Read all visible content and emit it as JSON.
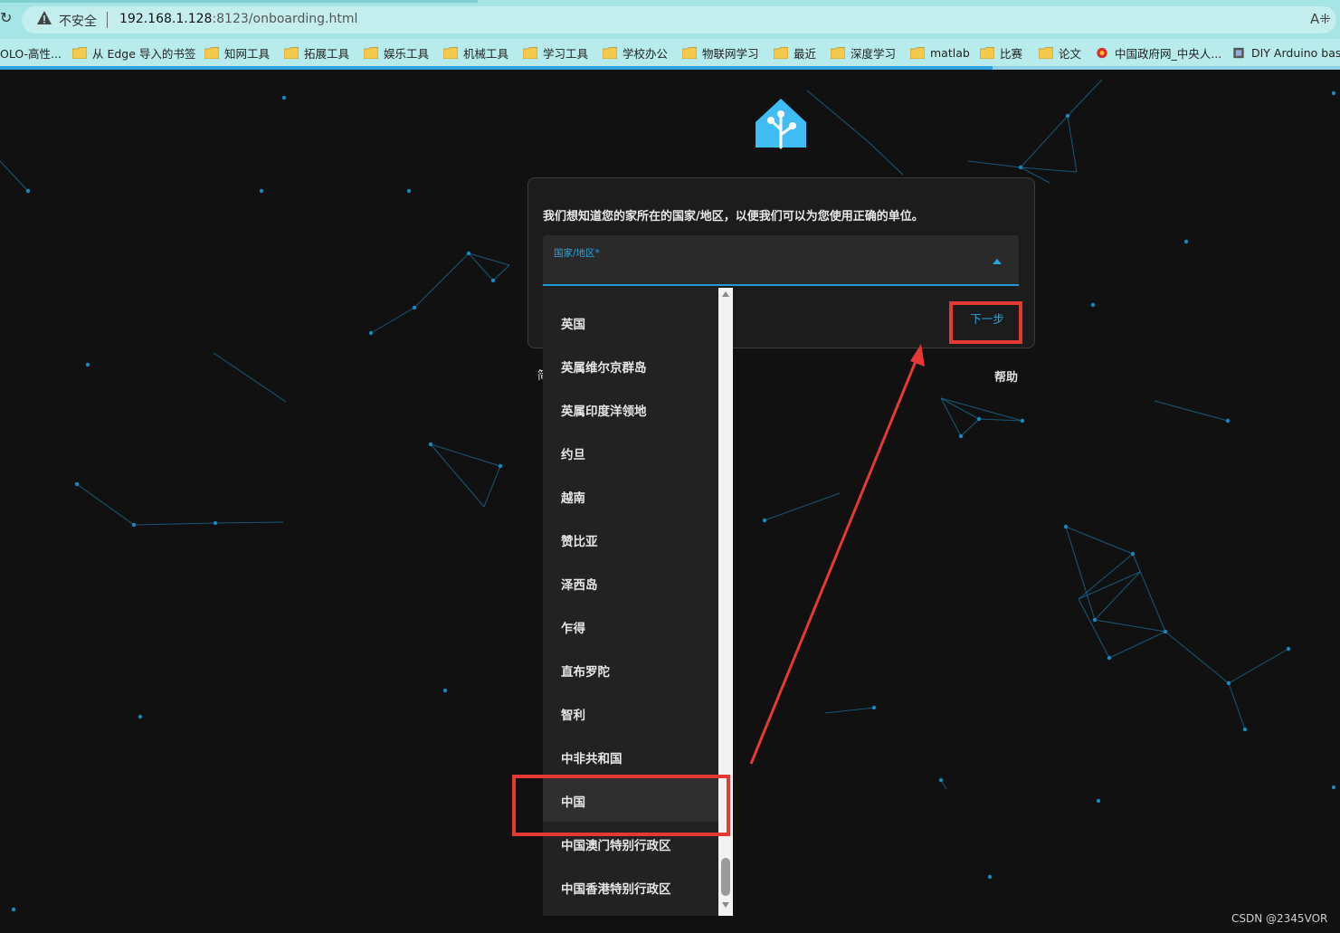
{
  "browser": {
    "security_label": "不安全",
    "url_host": "192.168.1.128",
    "url_rest": ":8123/onboarding.html",
    "read_aloud": "A͡",
    "bookmarks": [
      {
        "label": "OLO-高性...",
        "icon": "none"
      },
      {
        "label": "从 Edge 导入的书签",
        "icon": "folder-icon"
      },
      {
        "label": "知网工具",
        "icon": "folder-icon"
      },
      {
        "label": "拓展工具",
        "icon": "folder-icon"
      },
      {
        "label": "娱乐工具",
        "icon": "folder-icon"
      },
      {
        "label": "机械工具",
        "icon": "folder-icon"
      },
      {
        "label": "学习工具",
        "icon": "folder-icon"
      },
      {
        "label": "学校办公",
        "icon": "folder-icon"
      },
      {
        "label": "物联网学习",
        "icon": "folder-icon"
      },
      {
        "label": "最近",
        "icon": "folder-icon"
      },
      {
        "label": "深度学习",
        "icon": "folder-icon"
      },
      {
        "label": "matlab",
        "icon": "folder-icon"
      },
      {
        "label": "比赛",
        "icon": "folder-icon"
      },
      {
        "label": "论文",
        "icon": "folder-icon"
      },
      {
        "label": "中国政府网_中央人...",
        "icon": "emblem-icon"
      },
      {
        "label": "DIY Arduino based",
        "icon": "site-icon"
      }
    ]
  },
  "onboarding": {
    "intro": "我们想知道您的家所在的国家/地区，以便我们可以为您使用正确的单位。",
    "country_field_label": "国家/地区*",
    "next_button": "下一步",
    "help_link": "帮助",
    "language_stub": "简"
  },
  "country_options": [
    "英国",
    "英属维尔京群岛",
    "英属印度洋领地",
    "约旦",
    "越南",
    "赞比亚",
    "泽西岛",
    "乍得",
    "直布罗陀",
    "智利",
    "中非共和国",
    "中国",
    "中国澳门特别行政区",
    "中国香港特别行政区"
  ],
  "selected_option": "中国",
  "watermark": "CSDN @2345VOR",
  "colors": {
    "accent": "#2aa3e0",
    "annotation": "#e53935",
    "background": "#111111",
    "card": "#1c1c1c"
  }
}
